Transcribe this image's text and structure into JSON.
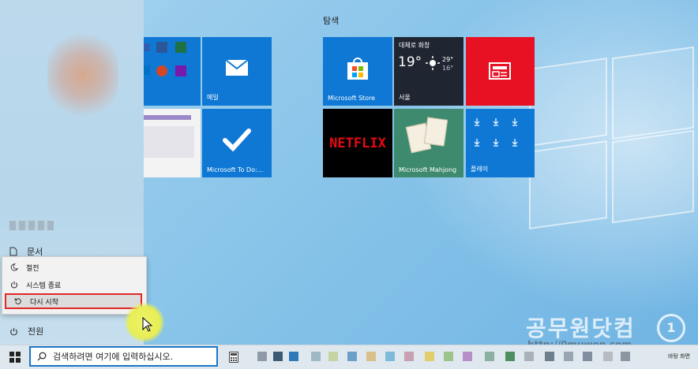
{
  "start_menu": {
    "group_title": "탐색",
    "side_items": [
      {
        "label": "문서",
        "icon": "document-icon"
      },
      {
        "label": "전원",
        "icon": "power-icon"
      }
    ],
    "power_menu": [
      {
        "label": "절전",
        "icon": "sleep-icon"
      },
      {
        "label": "시스템 종료",
        "icon": "power-icon"
      },
      {
        "label": "다시 시작",
        "icon": "restart-icon",
        "highlighted": true
      }
    ],
    "tiles": {
      "mail": "메일",
      "todo": "Microsoft To Do:...",
      "store": "Microsoft Store",
      "weather": {
        "condition": "대체로 화창",
        "temp": "19°",
        "high": "29°",
        "low": "16°",
        "city": "서울"
      },
      "netflix": "NETFLIX",
      "mahjong": "Microsoft Mahjong",
      "play": "플레이"
    }
  },
  "taskbar": {
    "search_placeholder": "검색하려면 여기에 입력하십시오.",
    "tray_text": "바탕 화면"
  },
  "watermark": {
    "text": "공무원닷컴",
    "url": "http://0muwon.com",
    "badge": "1"
  },
  "colors": {
    "tile_blue": "#0f78d4",
    "netflix_red": "#e50914",
    "news_red": "#e81123",
    "highlight_border": "#e32626"
  }
}
